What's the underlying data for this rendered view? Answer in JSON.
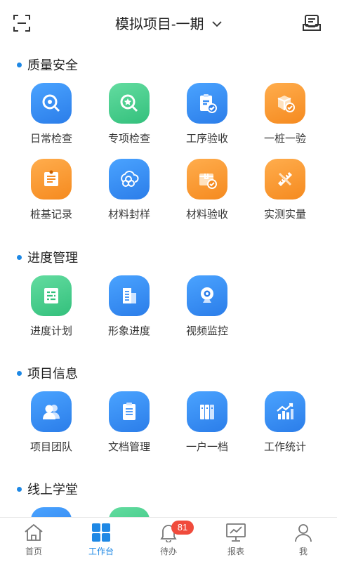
{
  "header": {
    "title": "模拟项目-一期",
    "scan_icon": "scan-icon",
    "inbox_icon": "inbox-icon"
  },
  "sections": [
    {
      "title": "质量安全",
      "items": [
        {
          "label": "日常检查",
          "icon": "search-icon",
          "color": "blue"
        },
        {
          "label": "专项检查",
          "icon": "star-search-icon",
          "color": "green"
        },
        {
          "label": "工序验收",
          "icon": "clipboard-check-icon",
          "color": "blue"
        },
        {
          "label": "一桩一验",
          "icon": "box-check-icon",
          "color": "orange"
        },
        {
          "label": "桩基记录",
          "icon": "note-icon",
          "color": "orange"
        },
        {
          "label": "材料封样",
          "icon": "cluster-icon",
          "color": "blue"
        },
        {
          "label": "材料验收",
          "icon": "package-check-icon",
          "color": "orange"
        },
        {
          "label": "实测实量",
          "icon": "ruler-pencil-icon",
          "color": "orange"
        }
      ]
    },
    {
      "title": "进度管理",
      "items": [
        {
          "label": "进度计划",
          "icon": "gantt-icon",
          "color": "green"
        },
        {
          "label": "形象进度",
          "icon": "building-icon",
          "color": "blue"
        },
        {
          "label": "视频监控",
          "icon": "camera-icon",
          "color": "blue"
        }
      ]
    },
    {
      "title": "项目信息",
      "items": [
        {
          "label": "项目团队",
          "icon": "team-icon",
          "color": "blue"
        },
        {
          "label": "文档管理",
          "icon": "document-icon",
          "color": "blue"
        },
        {
          "label": "一户一档",
          "icon": "binders-icon",
          "color": "blue"
        },
        {
          "label": "工作统计",
          "icon": "stats-icon",
          "color": "blue"
        }
      ]
    },
    {
      "title": "线上学堂",
      "items": []
    }
  ],
  "tabbar": [
    {
      "label": "首页",
      "icon": "home-icon",
      "active": false
    },
    {
      "label": "工作台",
      "icon": "grid-icon",
      "active": true
    },
    {
      "label": "待办",
      "icon": "bell-icon",
      "active": false,
      "badge": "81"
    },
    {
      "label": "报表",
      "icon": "chart-board-icon",
      "active": false
    },
    {
      "label": "我",
      "icon": "user-icon",
      "active": false
    }
  ],
  "colors": {
    "accent": "#1e88e5",
    "badge": "#f04b3c",
    "blue": "#3a8ff5",
    "green": "#45cc8a",
    "orange": "#fa9a33"
  }
}
